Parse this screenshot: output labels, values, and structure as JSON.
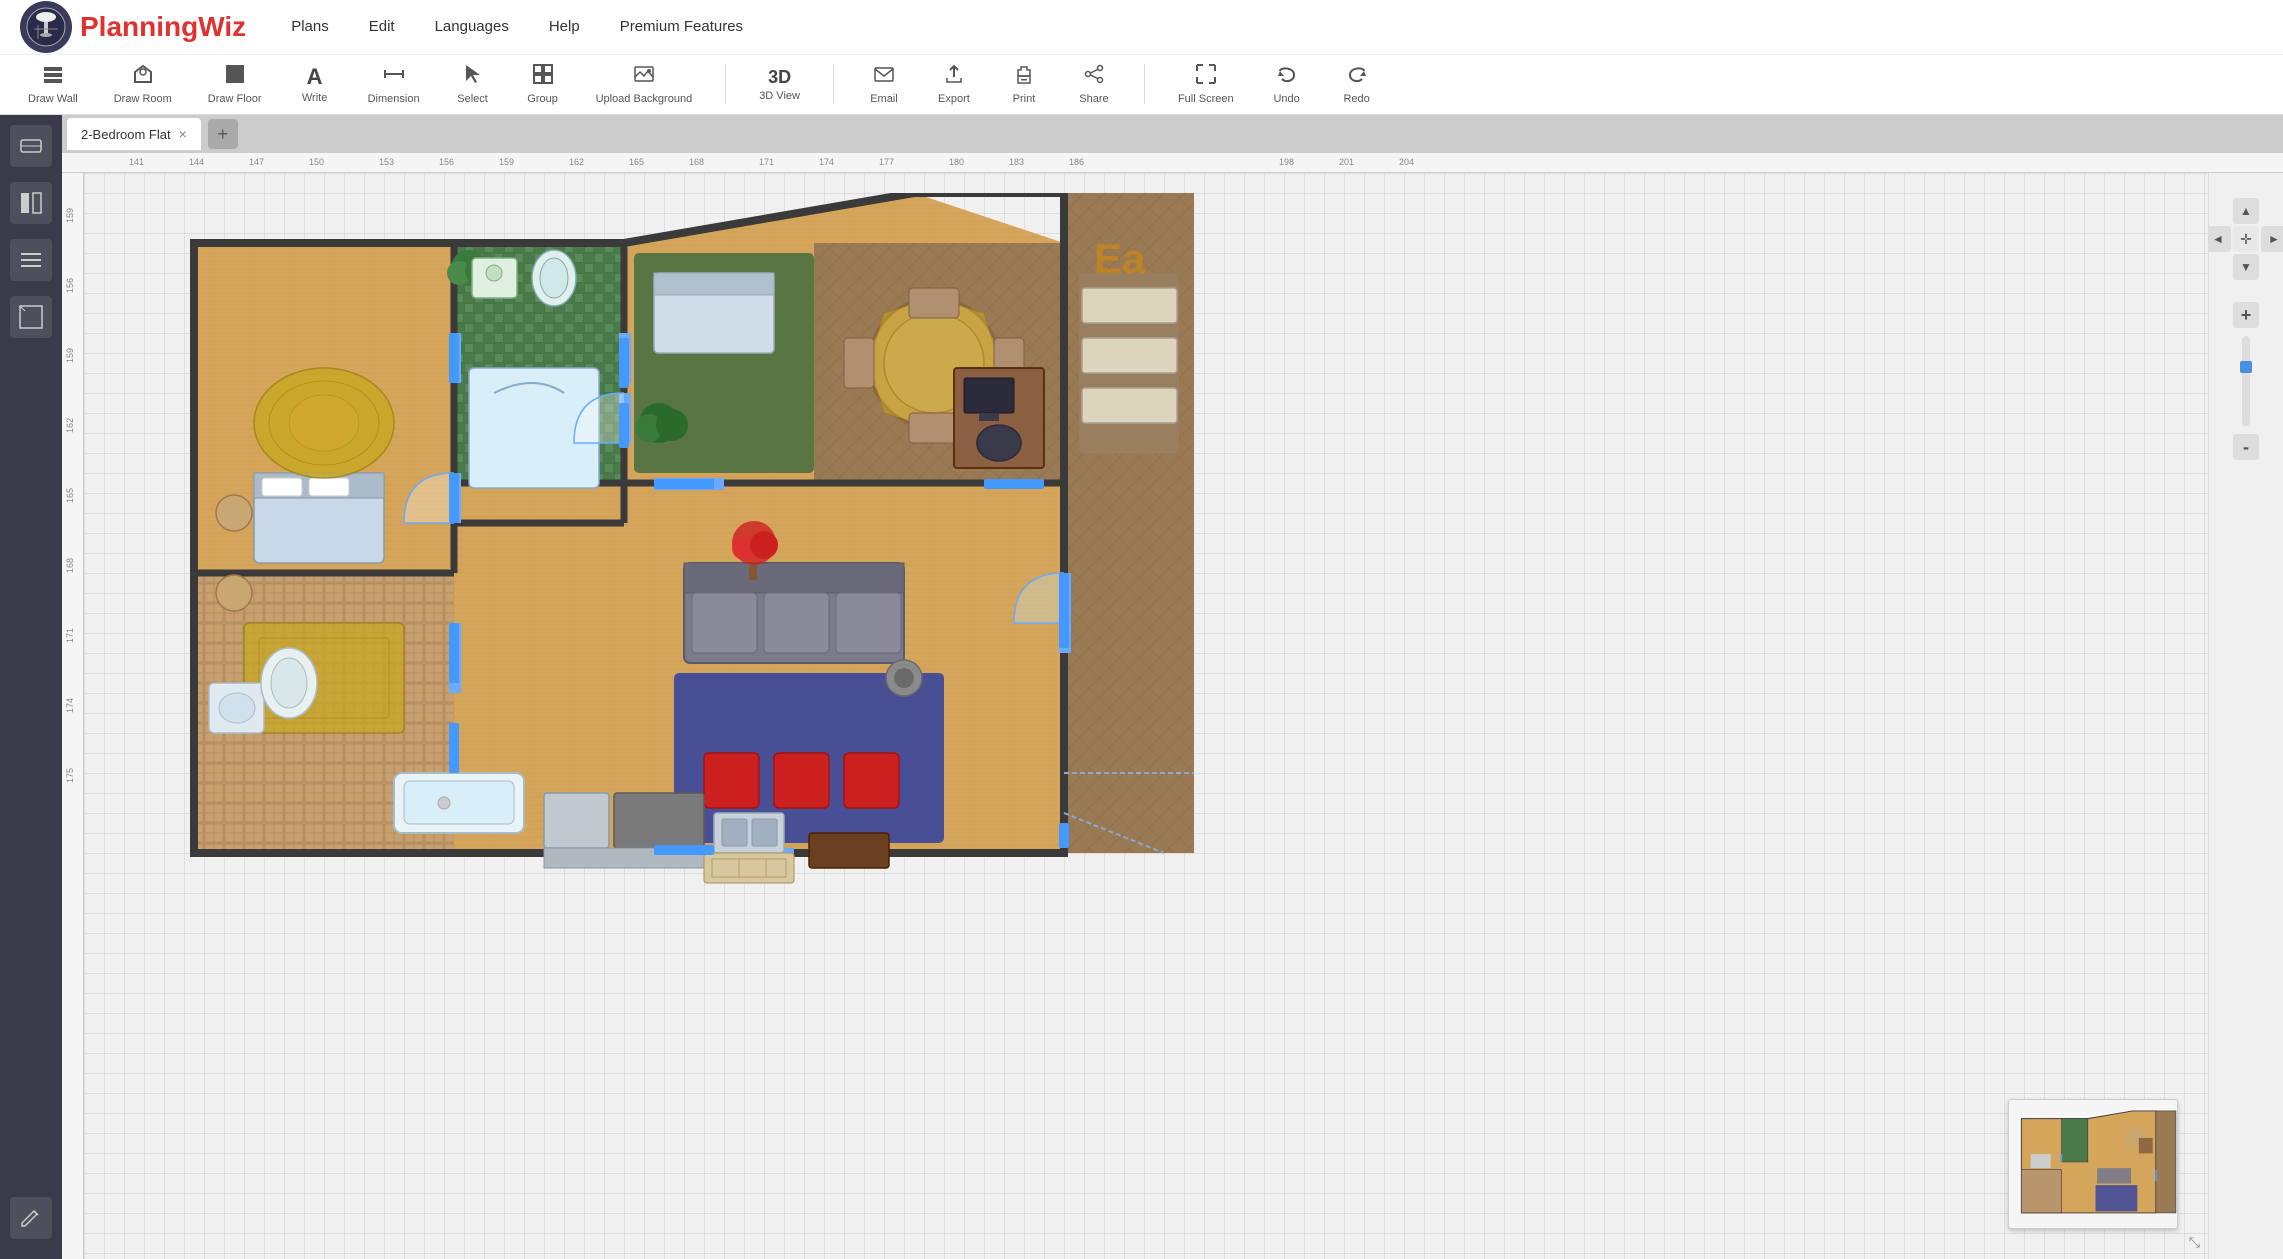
{
  "app": {
    "logo_text": "PlanningWiz",
    "logo_color": "#e03030"
  },
  "menu": {
    "items": [
      "Plans",
      "Edit",
      "Languages",
      "Help",
      "Premium Features"
    ]
  },
  "toolbar": {
    "tools": [
      {
        "id": "draw-wall",
        "label": "Draw Wall",
        "icon": "⊞"
      },
      {
        "id": "draw-room",
        "label": "Draw Room",
        "icon": "⟳"
      },
      {
        "id": "draw-floor",
        "label": "Draw Floor",
        "icon": "◼"
      },
      {
        "id": "write",
        "label": "Write",
        "icon": "A"
      },
      {
        "id": "dimension",
        "label": "Dimension",
        "icon": "↔"
      },
      {
        "id": "select",
        "label": "Select",
        "icon": "↖"
      },
      {
        "id": "group",
        "label": "Group",
        "icon": "⊡"
      },
      {
        "id": "upload-bg",
        "label": "Upload Background",
        "icon": "🖼"
      },
      {
        "id": "3d-view",
        "label": "3D View",
        "icon": "3D"
      },
      {
        "id": "email",
        "label": "Email",
        "icon": "✉"
      },
      {
        "id": "export",
        "label": "Export",
        "icon": "⬆"
      },
      {
        "id": "print",
        "label": "Print",
        "icon": "🖨"
      },
      {
        "id": "share",
        "label": "Share",
        "icon": "⚡"
      },
      {
        "id": "full-screen",
        "label": "Full Screen",
        "icon": "⤢"
      },
      {
        "id": "undo",
        "label": "Undo",
        "icon": "↺"
      },
      {
        "id": "redo",
        "label": "Redo",
        "icon": "↻"
      }
    ]
  },
  "tabs": {
    "items": [
      {
        "id": "tab-1",
        "label": "2-Bedroom Flat",
        "active": true,
        "closable": true
      }
    ],
    "add_label": "+"
  },
  "sidebar": {
    "buttons": [
      {
        "id": "furniture",
        "icon": "🛋"
      },
      {
        "id": "walls",
        "icon": "▐"
      },
      {
        "id": "stairs",
        "icon": "≡"
      },
      {
        "id": "dimensions",
        "icon": "⊞"
      },
      {
        "id": "edit",
        "icon": "✏"
      }
    ]
  },
  "ruler": {
    "h_marks": [
      "141",
      "144",
      "147",
      "150",
      "153",
      "156",
      "159",
      "162",
      "165",
      "168",
      "171",
      "174",
      "177",
      "180",
      "183",
      "186",
      "198",
      "201",
      "204"
    ],
    "v_marks": [
      "159",
      "156",
      "159",
      "162",
      "165",
      "168",
      "171",
      "174",
      "175"
    ]
  },
  "navigation": {
    "up": "▲",
    "down": "▼",
    "left": "◄",
    "right": "►",
    "center": "✛",
    "zoom_in": "+",
    "zoom_out": "-"
  },
  "plan_title": "2-Bedroom Flat",
  "ea_label": "Ea"
}
